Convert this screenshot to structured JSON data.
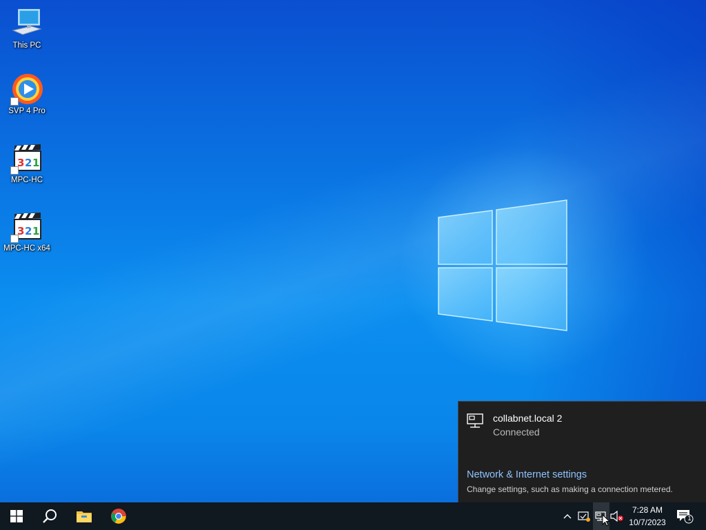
{
  "desktop": {
    "icons": [
      {
        "label": "This PC",
        "icon": "this-pc-icon"
      },
      {
        "label": "SVP 4 Pro",
        "icon": "svp-icon"
      },
      {
        "label": "MPC-HC",
        "icon": "mpc-hc-icon"
      },
      {
        "label": "MPC-HC x64",
        "icon": "mpc-hc-x64-icon"
      }
    ]
  },
  "network_flyout": {
    "network_name": "collabnet.local 2",
    "status": "Connected",
    "settings_link": "Network & Internet settings",
    "settings_desc": "Change settings, such as making a connection metered."
  },
  "taskbar": {
    "pinned": [
      "start-icon",
      "search-icon",
      "file-explorer-icon",
      "chrome-icon"
    ],
    "tray_icons": [
      "chevron-up-icon",
      "security-icon",
      "network-icon",
      "volume-muted-icon"
    ],
    "clock": {
      "time": "7:28 AM",
      "date": "10/7/2023"
    },
    "notifications": {
      "count": "1"
    }
  },
  "colors": {
    "flyout_bg": "#1f1f1f",
    "link": "#8fc3ff",
    "taskbar_bg": "#101820"
  }
}
